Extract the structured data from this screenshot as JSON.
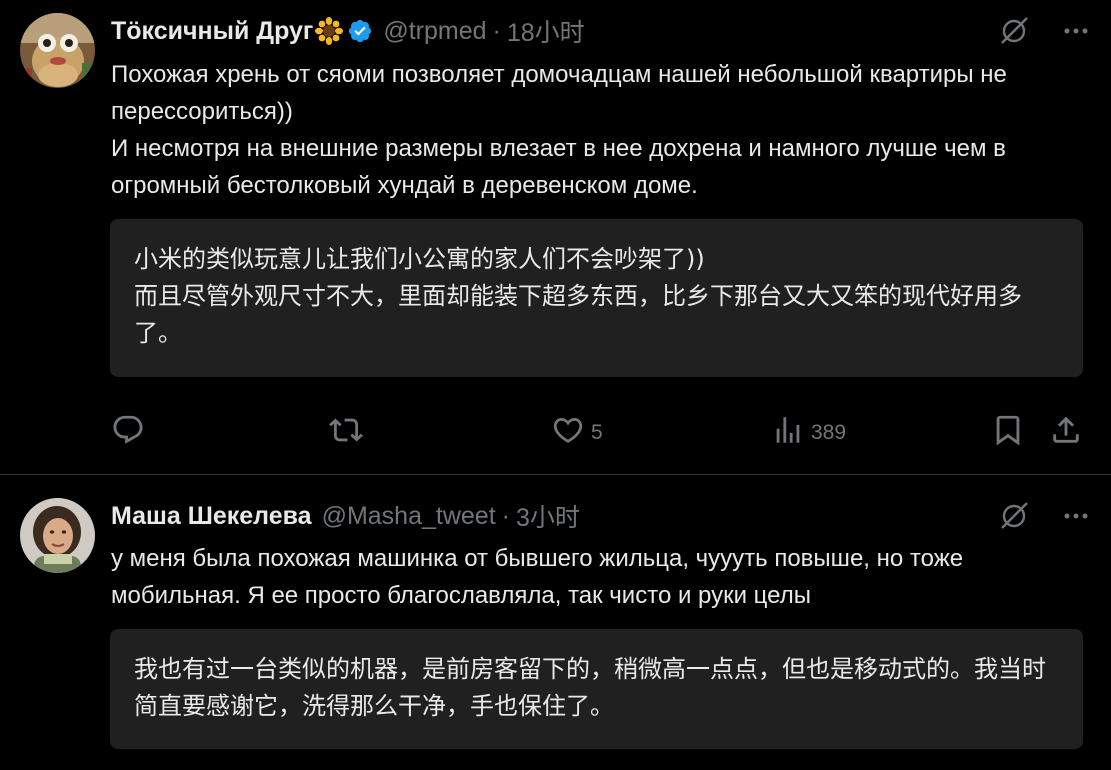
{
  "tweets": [
    {
      "author": {
        "name": "Тӧксичный Друг",
        "name_emoji": "sunflower",
        "verified": true,
        "handle": "@trpmed",
        "time": "18小时"
      },
      "text": [
        "Похожая хрень от сяоми позволяет домочадцам нашей небольшой квартиры не перессориться))",
        "И несмотря на внешние размеры влезает в нее дохрена и намного лучше чем в огромный бестолковый хундай в деревенском доме."
      ],
      "translation": [
        "小米的类似玩意儿让我们小公寓的家人们不会吵架了))",
        "而且尽管外观尺寸不大，里面却能装下超多东西，比乡下那台又大又笨的现代好用多了。"
      ],
      "actions": {
        "replies": "",
        "reposts": "",
        "likes": "5",
        "views": "389"
      }
    },
    {
      "author": {
        "name": "Маша Шекелева",
        "handle": "@Masha_tweet",
        "time": "3小时"
      },
      "text": [
        "у меня была похожая машинка от бывшего жильца, чуууть повыше, но тоже мобильная. Я ее просто благославляла, так чисто и руки целы"
      ],
      "translation": [
        "我也有过一台类似的机器，是前房客留下的，稍微高一点点，但也是移动式的。我当时简直要感谢它，洗得那么干净，手也保住了。"
      ]
    }
  ],
  "icons": {
    "grok": "grok-icon",
    "more": "more-icon",
    "reply": "reply-icon",
    "repost": "repost-icon",
    "like": "heart-icon",
    "views": "views-icon",
    "bookmark": "bookmark-icon",
    "share": "share-icon"
  },
  "colors": {
    "background": "#000000",
    "text": "#e7e9ea",
    "muted": "#71767b",
    "translation_bg": "#202020",
    "divider": "#2f3336",
    "verified": "#1d9bf0"
  }
}
